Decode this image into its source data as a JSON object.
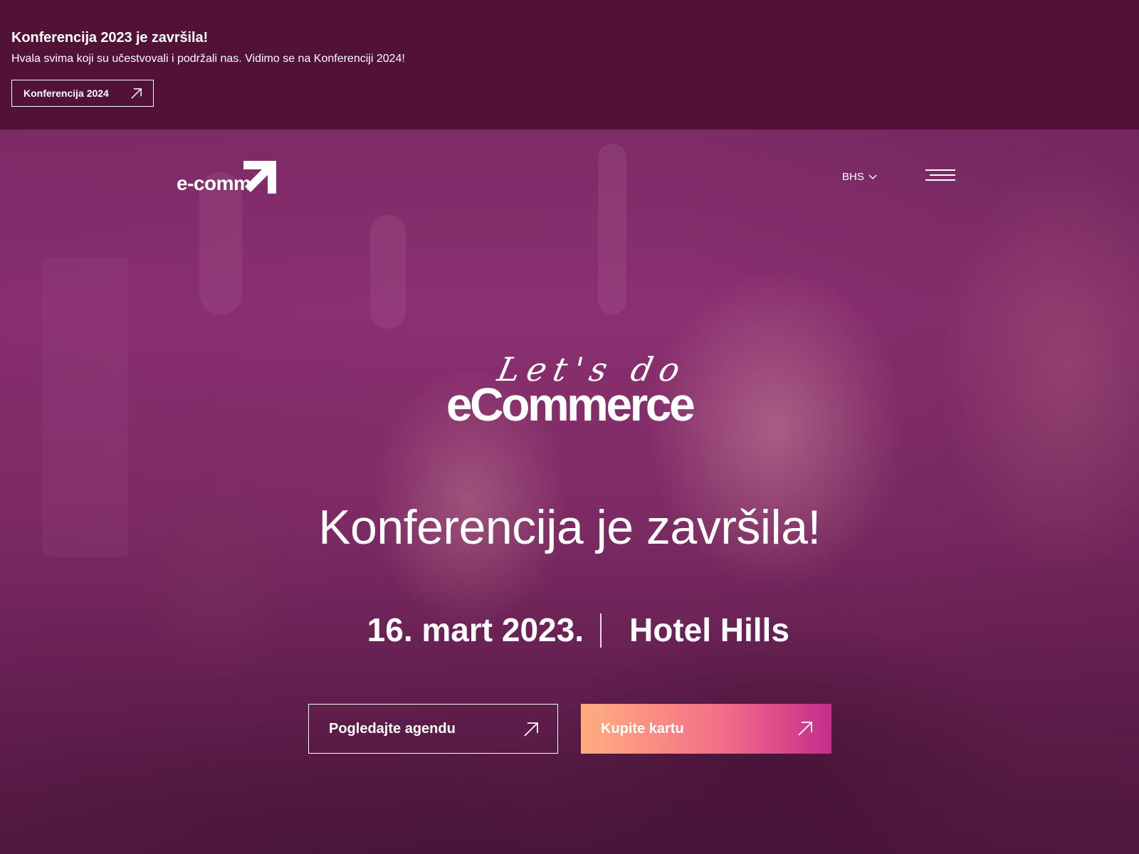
{
  "banner": {
    "title": "Konferencija 2023 je završila!",
    "text": "Hvala svima koji su učestvovali i podržali nas. Vidimo se na Konferenciji 2024!",
    "button_label": "Konferencija 2024",
    "background_color": "#521238"
  },
  "header": {
    "logo_text": "e-comm",
    "language": "BHS",
    "language_icon": "chevron-down-icon",
    "menu_icon": "hamburger-menu-icon"
  },
  "hero": {
    "script_text": "Let's do",
    "brand_text": "eCommerce",
    "headline": "Konferencija je završila!",
    "date": "16. mart 2023.",
    "venue": "Hotel Hills",
    "buttons": [
      {
        "label": "Pogledajte agendu",
        "icon": "arrow-up-right-icon"
      },
      {
        "label": "Kupite kartu",
        "icon": "arrow-up-right-icon"
      }
    ],
    "gradient_colors": [
      "#ffae7e",
      "#f47088",
      "#c52c8c"
    ]
  }
}
